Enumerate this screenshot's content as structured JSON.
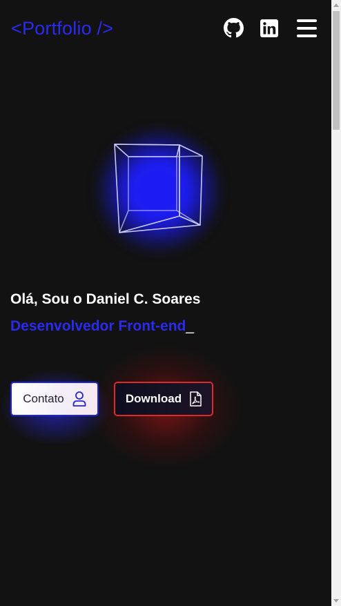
{
  "header": {
    "logo": "<Portfolio />",
    "icons": {
      "github": "github-icon",
      "linkedin": "linkedin-icon",
      "menu": "menu-icon"
    }
  },
  "hero": {
    "greeting": "Olá, Sou o Daniel C. Soares",
    "role": "Desenvolvedor Front-end",
    "cursor": "_"
  },
  "buttons": {
    "contact_label": "Contato",
    "contact_icon": "user-icon",
    "download_label": "Download",
    "download_icon": "pdf-file-icon"
  },
  "colors": {
    "background": "#121212",
    "accent_blue": "#2b2bf0",
    "accent_red": "#e02a2a",
    "text": "#ffffff"
  }
}
